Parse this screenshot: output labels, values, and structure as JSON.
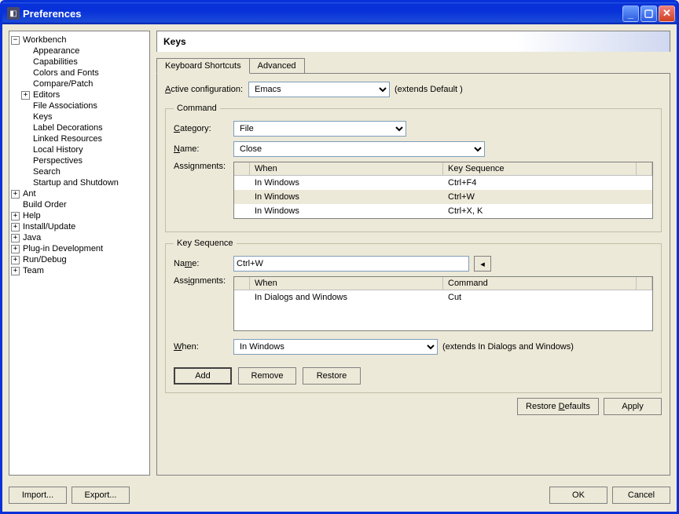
{
  "window": {
    "title": "Preferences"
  },
  "tree": {
    "workbench": "Workbench",
    "wb_children": [
      "Appearance",
      "Capabilities",
      "Colors and Fonts",
      "Compare/Patch",
      "Editors",
      "File Associations",
      "Keys",
      "Label Decorations",
      "Linked Resources",
      "Local History",
      "Perspectives",
      "Search",
      "Startup and Shutdown"
    ],
    "roots": [
      "Ant",
      "Build Order",
      "Help",
      "Install/Update",
      "Java",
      "Plug-in Development",
      "Run/Debug",
      "Team"
    ]
  },
  "page": {
    "title": "Keys",
    "tabs": {
      "shortcuts": "Keyboard Shortcuts",
      "advanced": "Advanced"
    },
    "config_label": "Active configuration:",
    "config_value": "Emacs",
    "config_extends": "(extends Default )"
  },
  "command": {
    "legend": "Command",
    "category_label": "Category:",
    "category_value": "File",
    "name_label": "Name:",
    "name_value": "Close",
    "assignments_label": "Assignments:",
    "headers": {
      "when": "When",
      "key": "Key Sequence"
    },
    "rows": [
      {
        "when": "In Windows",
        "key": "Ctrl+F4"
      },
      {
        "when": "In Windows",
        "key": "Ctrl+W"
      },
      {
        "when": "In Windows",
        "key": "Ctrl+X, K"
      }
    ]
  },
  "keyseq": {
    "legend": "Key Sequence",
    "name_label": "Name:",
    "name_value": "Ctrl+W",
    "assignments_label": "Assignments:",
    "headers": {
      "when": "When",
      "cmd": "Command"
    },
    "rows": [
      {
        "when": "In Dialogs and Windows",
        "cmd": "Cut"
      }
    ],
    "when_label": "When:",
    "when_value": "In Windows",
    "when_extends": "(extends In Dialogs and Windows)"
  },
  "actions": {
    "add": "Add",
    "remove": "Remove",
    "restore": "Restore",
    "restore_defaults": "Restore Defaults",
    "apply": "Apply",
    "import": "Import...",
    "export": "Export...",
    "ok": "OK",
    "cancel": "Cancel"
  }
}
